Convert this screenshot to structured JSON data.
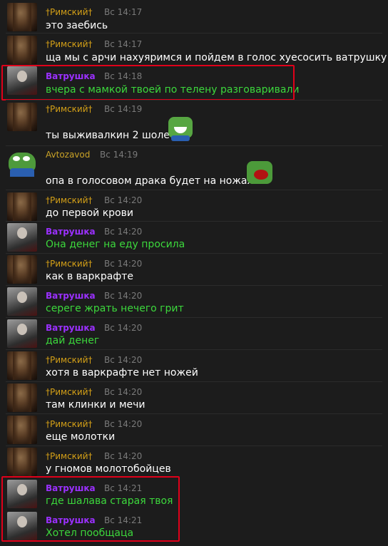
{
  "messages": [
    {
      "author": "†Римский†",
      "time": "Вс 14:17",
      "text": "это заебись"
    },
    {
      "author": "†Римский†",
      "time": "Вс 14:17",
      "text": "ща мы с арчи нахуяримся и пойдем в голос хуесосить ватрушку"
    },
    {
      "author": "Ватрушка",
      "time": "Вс 14:18",
      "text": "вчера с мамкой твоей по телену разговаривали"
    },
    {
      "author": "†Римский†",
      "time": "Вс 14:19",
      "text": "ты выживалкин 2 шоле"
    },
    {
      "author": "Avtozavod",
      "time": "Вс 14:19",
      "text": "опа в голосовом драка будет на ножах"
    },
    {
      "author": "†Римский†",
      "time": "Вс 14:20",
      "text": "до первой крови"
    },
    {
      "author": "Ватрушка",
      "time": "Вс 14:20",
      "text": "Она денег на еду просила"
    },
    {
      "author": "†Римский†",
      "time": "Вс 14:20",
      "text": "как в варкрафте"
    },
    {
      "author": "Ватрушка",
      "time": "Вс 14:20",
      "text": "сереге жрать нечего грит"
    },
    {
      "author": "Ватрушка",
      "time": "Вс 14:20",
      "text": "дай денег"
    },
    {
      "author": "†Римский†",
      "time": "Вс 14:20",
      "text": "хотя в варкрафте нет ножей"
    },
    {
      "author": "†Римский†",
      "time": "Вс 14:20",
      "text": "там клинки и мечи"
    },
    {
      "author": "†Римский†",
      "time": "Вс 14:20",
      "text": "еще молотки"
    },
    {
      "author": "†Римский†",
      "time": "Вс 14:20",
      "text": "у гномов молотобойцев"
    },
    {
      "author": "Ватрушка",
      "time": "Вс 14:21",
      "text": "где шалава старая твоя"
    },
    {
      "author": "Ватрушка",
      "time": "Вс 14:21",
      "text": "Хотел пообщаца"
    }
  ]
}
